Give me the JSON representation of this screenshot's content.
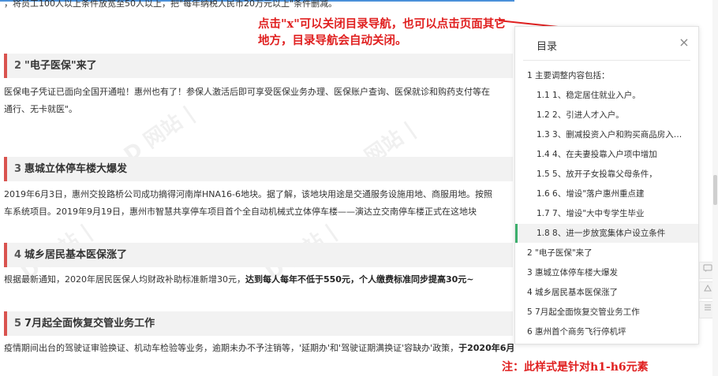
{
  "article": {
    "intro_text": "，将员工100人以上条件放宽至50人以上，把\"每年纳税人民币20万元以上\"条件删减。",
    "sections": [
      {
        "num": "2",
        "title": "\"电子医保\"来了",
        "paragraphs": [
          "医保电子凭证已面向全国开通啦！惠州也有了！参保人激活后即可享受医保业务办理、医保账户查询、医保就诊和购药支付等在",
          "通行、无卡就医\"。"
        ]
      },
      {
        "num": "3",
        "title": "惠城立体停车楼大爆发",
        "paragraphs": [
          "2019年6月3日，惠州交投路桥公司成功摘得河南岸HNA16-6地块。据了解，该地块用途是交通服务设施用地、商服用地。按照",
          "车系统项目。2019年9月19日，惠州市智慧共享停车项目首个全自动机械式立体停车楼——演达立交南停车楼正式在这地块"
        ]
      },
      {
        "num": "4",
        "title": "城乡居民基本医保涨了",
        "para_normal": "根据最新通知，2020年居民医保人均财政补助标准新增30元，",
        "para_bold": "达到每人每年不低于550元，个人缴费标准同步提高30元~"
      },
      {
        "num": "5",
        "title": "7月起全面恢复交管业务工作",
        "para_normal": "疫情期间出台的驾驶证审验换证、机动车检验等业务，逾期未办不予注销等，'延期办'和'驾驶证期满换证'容缺办'政策，",
        "para_bold": "于2020年6月30日停止执行！"
      }
    ]
  },
  "annotation": {
    "text": "点击\"x\"可以关闭目录导航，也可以点击页面其它地方，目录导航会自动关闭。",
    "footer_note": "注：此样式是针对h1-h6元素",
    "color": "#e02020"
  },
  "toc": {
    "title": "目录",
    "close_glyph": "×",
    "items": [
      {
        "label": "1 主要调整内容包括：",
        "level": 1,
        "active": false
      },
      {
        "label": "1.1 1、稳定居住就业入户。",
        "level": 2,
        "active": false
      },
      {
        "label": "1.2 2、引进人才入户。",
        "level": 2,
        "active": false
      },
      {
        "label": "1.3 3、删减投资入户和购买商品房入…",
        "level": 2,
        "active": false
      },
      {
        "label": "1.4 4、在夫妻投靠入户项中增加",
        "level": 2,
        "active": false
      },
      {
        "label": "1.5 5、放开子女投靠父母条件，",
        "level": 2,
        "active": false
      },
      {
        "label": "1.6 6、增设\"落户惠州重点建",
        "level": 2,
        "active": false
      },
      {
        "label": "1.7 7、增设\"大中专学生毕业",
        "level": 2,
        "active": false
      },
      {
        "label": "1.8 8、进一步放宽集体户设立条件",
        "level": 2,
        "active": true
      },
      {
        "label": "2 \"电子医保\"来了",
        "level": 1,
        "active": false
      },
      {
        "label": "3 惠城立体停车楼大爆发",
        "level": 1,
        "active": false
      },
      {
        "label": "4 城乡居民基本医保涨了",
        "level": 1,
        "active": false
      },
      {
        "label": "5 7月起全面恢复交管业务工作",
        "level": 1,
        "active": false
      },
      {
        "label": "6 惠州首个商务飞行停机坪",
        "level": 1,
        "active": false
      }
    ],
    "active_color": "#3cae6c"
  },
  "icons": {
    "tools": [
      "comment-icon",
      "share-icon",
      "list-icon"
    ]
  }
}
